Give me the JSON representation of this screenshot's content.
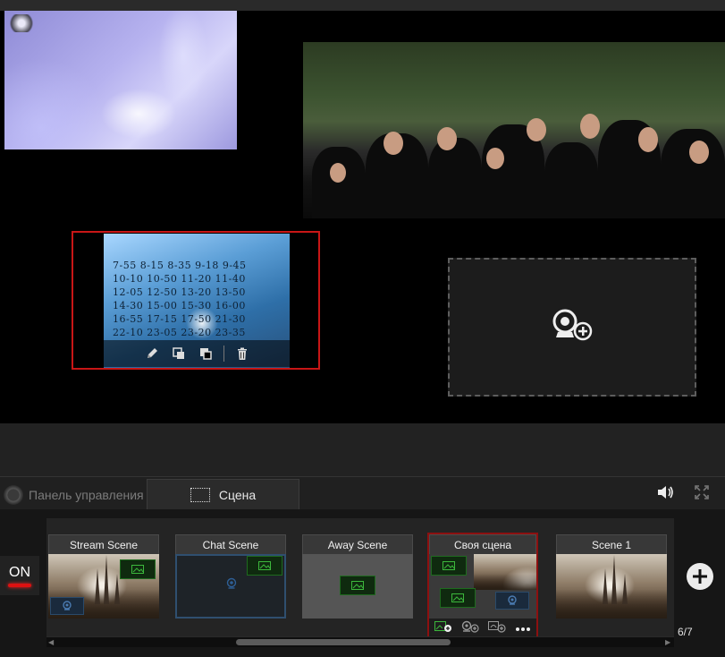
{
  "preview": {
    "timetable_rows": [
      "7-55  8-15  8-35  9-18  9-45",
      "10-10 10-50 11-20 11-40",
      "12-05 12-50 13-20 13-50",
      "14-30 15-00 15-30 16-00",
      "16-55 17-15 17-50 21-30",
      "22-10 23-05 23-20 23-35"
    ],
    "source_tools": [
      "edit-icon",
      "bring-forward-icon",
      "send-backward-icon",
      "delete-icon"
    ],
    "placeholder_icon": "add-webcam-icon"
  },
  "tabs": {
    "dashboard": "Панель управления",
    "scene": "Сцена",
    "right_icons": [
      "volume-icon",
      "fullscreen-icon"
    ]
  },
  "strip": {
    "on_label": "ON",
    "scenes": [
      {
        "label": "Stream Scene"
      },
      {
        "label": "Chat Scene"
      },
      {
        "label": "Away Scene"
      },
      {
        "label": "Своя сцена"
      },
      {
        "label": "Scene 1"
      }
    ],
    "counter": "6/7"
  },
  "colors": {
    "selection_border": "#c81616",
    "active_scene_border": "#8c1010",
    "on_indicator": "#dd1111",
    "source_green": "#1e6a1e",
    "chat_scene_border": "#2f4f6f"
  }
}
